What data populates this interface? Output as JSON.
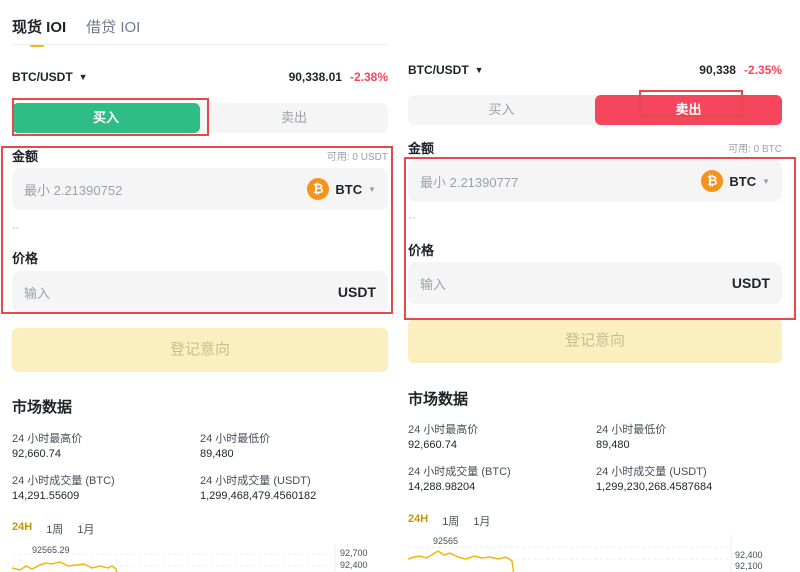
{
  "tabs": {
    "spot": "现货 IOI",
    "borrow": "借贷 IOI"
  },
  "colors": {
    "buy": "#2ebd85",
    "sell": "#f6465d",
    "accent": "#f0b90b",
    "highlight": "#e5484d"
  },
  "left": {
    "pair": "BTC/USDT",
    "price": "90,338.01",
    "change": "-2.38%",
    "buy_label": "买入",
    "sell_label": "卖出",
    "active_side": "buy",
    "amount_label": "金额",
    "available": "可用: 0 USDT",
    "amount_placeholder": "最小 2.21390752",
    "amount_coin": "BTC",
    "dash": "--",
    "price_label": "价格",
    "price_placeholder": "输入",
    "price_unit": "USDT",
    "submit": "登记意向",
    "market_title": "市场数据",
    "high_label": "24 小时最高价",
    "high_value": "92,660.74",
    "low_label": "24 小时最低价",
    "low_value": "89,480",
    "vol_btc_label": "24 小时成交量 (BTC)",
    "vol_btc_value": "14,291.55609",
    "vol_usdt_label": "24 小时成交量 (USDT)",
    "vol_usdt_value": "1,299,468,479.4560182",
    "periods": [
      "24H",
      "1周",
      "1月"
    ],
    "chart_peak": "92565.29",
    "axis_top": "92,700",
    "axis_next": "92,400"
  },
  "right": {
    "pair": "BTC/USDT",
    "price": "90,338",
    "change": "-2.35%",
    "buy_label": "买入",
    "sell_label": "卖出",
    "active_side": "sell",
    "amount_label": "金额",
    "available": "可用: 0 BTC",
    "amount_placeholder": "最小 2.21390777",
    "amount_coin": "BTC",
    "dash": "--",
    "price_label": "价格",
    "price_placeholder": "输入",
    "price_unit": "USDT",
    "submit": "登记意向",
    "market_title": "市场数据",
    "high_label": "24 小时最高价",
    "high_value": "92,660.74",
    "low_label": "24 小时最低价",
    "low_value": "89,480",
    "vol_btc_label": "24 小时成交量 (BTC)",
    "vol_btc_value": "14,288.98204",
    "vol_usdt_label": "24 小时成交量 (USDT)",
    "vol_usdt_value": "1,299,230,268.4587684",
    "periods": [
      "24H",
      "1周",
      "1月"
    ],
    "chart_peak": "92565",
    "axis_top": "92,400",
    "axis_next": "92,100"
  }
}
